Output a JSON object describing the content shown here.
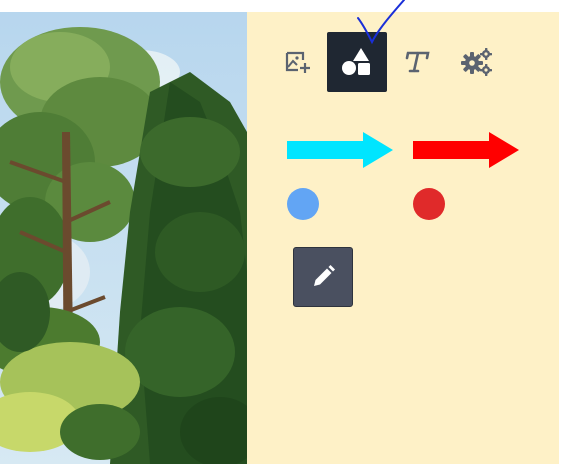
{
  "canvas": {
    "image": "tree-painting"
  },
  "toolbar": {
    "items": [
      {
        "name": "add-image",
        "icon": "image-plus-icon",
        "active": false
      },
      {
        "name": "shapes",
        "icon": "shapes-icon",
        "active": true
      },
      {
        "name": "text",
        "icon": "text-t-icon",
        "label": "T",
        "active": false
      },
      {
        "name": "settings",
        "icon": "gears-icon",
        "active": false
      }
    ]
  },
  "shapes": {
    "arrows": [
      {
        "name": "cyan-arrow",
        "color": "#00e5ff"
      },
      {
        "name": "red-arrow",
        "color": "#ff0000"
      }
    ],
    "dots": [
      {
        "name": "blue-dot",
        "color": "#62a5f4"
      },
      {
        "name": "red-dot",
        "color": "#e02a2a"
      }
    ]
  },
  "edit_button": {
    "icon": "pencil-icon"
  },
  "colors": {
    "panel_bg": "#fef1c7",
    "active_tool_bg": "#1f2732",
    "icon_gray": "#5b6370",
    "annotation_stroke": "#1a2fd8"
  }
}
